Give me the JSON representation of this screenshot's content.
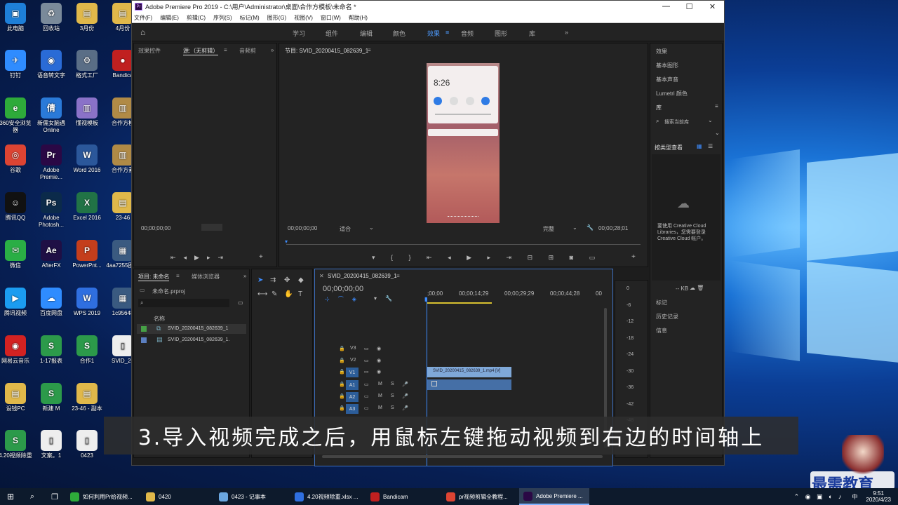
{
  "desktop": {
    "icons": [
      {
        "label": "此电脑",
        "color": "#1e7fd8",
        "glyph": "▣"
      },
      {
        "label": "回收站",
        "color": "#7a8a9a",
        "glyph": "♻"
      },
      {
        "label": "3月份",
        "color": "#e0b84a",
        "glyph": "▤"
      },
      {
        "label": "4月份",
        "color": "#e0b84a",
        "glyph": "▤"
      },
      {
        "label": "钉钉",
        "color": "#2f8cff",
        "glyph": "✈"
      },
      {
        "label": "语音转文字",
        "color": "#2a6bd6",
        "glyph": "◉"
      },
      {
        "label": "格式工厂",
        "color": "#5a6e86",
        "glyph": "⚙"
      },
      {
        "label": "Bandica",
        "color": "#c02020",
        "glyph": "●"
      },
      {
        "label": "360安全浏览器",
        "color": "#2eaa3a",
        "glyph": "e"
      },
      {
        "label": "新儒女脑遇Online",
        "color": "#2a7ad8",
        "glyph": "倩"
      },
      {
        "label": "懂视模板",
        "color": "#8a72c8",
        "glyph": "▥"
      },
      {
        "label": "合作方模",
        "color": "#b08a46",
        "glyph": "▥"
      },
      {
        "label": "谷歌",
        "color": "#dd4433",
        "glyph": "◎"
      },
      {
        "label": "Adobe Premie...",
        "color": "#2a0845",
        "glyph": "Pr"
      },
      {
        "label": "Word 2016",
        "color": "#2b579a",
        "glyph": "W"
      },
      {
        "label": "合作方素",
        "color": "#b08a46",
        "glyph": "▥"
      },
      {
        "label": "腾讯QQ",
        "color": "#111111",
        "glyph": "☺"
      },
      {
        "label": "Adobe Photosh...",
        "color": "#0b2a4a",
        "glyph": "Ps"
      },
      {
        "label": "Excel 2016",
        "color": "#217346",
        "glyph": "X"
      },
      {
        "label": "23-46",
        "color": "#e0b84a",
        "glyph": "▤"
      },
      {
        "label": "微信",
        "color": "#2aae45",
        "glyph": "✉"
      },
      {
        "label": "AfterFX",
        "color": "#1f0f45",
        "glyph": "Ae"
      },
      {
        "label": "PowerPnt...",
        "color": "#c43e1c",
        "glyph": "P"
      },
      {
        "label": "4aa7255图片",
        "color": "#3a5a80",
        "glyph": "▦"
      },
      {
        "label": "腾讯视频",
        "color": "#1b9cf0",
        "glyph": "▶"
      },
      {
        "label": "百度网盘",
        "color": "#2f8cff",
        "glyph": "☁"
      },
      {
        "label": "WPS 2019",
        "color": "#2f6fe0",
        "glyph": "W"
      },
      {
        "label": "1c95648",
        "color": "#3a5a80",
        "glyph": "▦"
      },
      {
        "label": "网易云音乐",
        "color": "#d32222",
        "glyph": "◉"
      },
      {
        "label": "1-17报表",
        "color": "#2c9a4a",
        "glyph": "S"
      },
      {
        "label": "合作1",
        "color": "#2c9a4a",
        "glyph": "S"
      },
      {
        "label": "SVID_20",
        "color": "#eeeeee",
        "glyph": "▯"
      },
      {
        "label": "设钱PC",
        "color": "#e0b84a",
        "glyph": "▤"
      },
      {
        "label": "新建 M",
        "color": "#2c9a4a",
        "glyph": "S"
      },
      {
        "label": "23-46 - 副本",
        "color": "#e0b84a",
        "glyph": "▤"
      },
      {
        "label": "",
        "color": "#00000000",
        "glyph": ""
      },
      {
        "label": "4.20视频除重",
        "color": "#2c9a4a",
        "glyph": "S"
      },
      {
        "label": "文案。1",
        "color": "#eeeeee",
        "glyph": "▯"
      },
      {
        "label": "0423",
        "color": "#eeeeee",
        "glyph": "▯"
      }
    ]
  },
  "premiere": {
    "title": "Adobe Premiere Pro 2019 - C:\\用户\\Administrator\\桌面\\合作方模板\\未命名 *",
    "menu": [
      "文件(F)",
      "编辑(E)",
      "剪辑(C)",
      "序列(S)",
      "标记(M)",
      "图形(G)",
      "视图(V)",
      "窗口(W)",
      "帮助(H)"
    ],
    "workspaces": [
      "学习",
      "组件",
      "编辑",
      "颜色",
      "效果",
      "音频",
      "图形",
      "库"
    ],
    "active_workspace": "效果",
    "source_tabs": [
      "效果控件",
      "源:（无剪辑）",
      "音频剪"
    ],
    "source_tc": "00;00;00;00",
    "program_tab": "节目: SVID_20200415_082639_1",
    "program_tc": "00;00;00;00",
    "program_fit": "适合",
    "program_quality": "完整",
    "program_duration": "00;00;28;01",
    "phone_time": "8:26",
    "right_panel": {
      "items": [
        "效果",
        "基本图形",
        "基本声音",
        "Lumetri 颜色",
        "库"
      ],
      "search_placeholder": "搜索当前库",
      "view_label": "按类型查看",
      "cloud_text": "要使用 Creative Cloud Libraries，您需要登录 Creative Cloud 帐户。",
      "kb": "-- KB",
      "bottom": [
        "标记",
        "历史记录",
        "信息"
      ]
    },
    "project": {
      "tabs": [
        "项目: 未命名",
        "媒体浏览器"
      ],
      "file": "未命名.prproj",
      "col_name": "名称",
      "items": [
        "SVID_20200415_082639_1",
        "SVID_20200415_082639_1."
      ]
    },
    "timeline": {
      "tab": "SVID_20200415_082639_1",
      "tc": "00;00;00;00",
      "ruler": [
        ";00;00",
        "00;00;14;29",
        "00;00;29;29",
        "00;00;44;28",
        "00"
      ],
      "video_tracks": [
        "V3",
        "V2",
        "V1"
      ],
      "audio_tracks": [
        "A1",
        "A2",
        "A3"
      ],
      "clip_label": "SVID_20200415_082639_1.mp4 [V]"
    },
    "meter_labels": [
      "0",
      "-6",
      "-12",
      "-18",
      "-24",
      "-30",
      "-36",
      "-42",
      "-48"
    ]
  },
  "subtitle": "3.导入视频完成之后，用鼠标左键拖动视频到右边的时间轴上",
  "watermark": "最需教育",
  "taskbar": {
    "items": [
      {
        "label": "如何利用Pr给视频...",
        "color": "#2eaa3a"
      },
      {
        "label": "0420",
        "color": "#e0b84a"
      },
      {
        "label": "0423 - 记事本",
        "color": "#6aa6e0"
      },
      {
        "label": "4.20视频除重.xlsx ...",
        "color": "#2f6fe0"
      },
      {
        "label": "Bandicam",
        "color": "#c02020"
      },
      {
        "label": "pr视频剪辑全教程...",
        "color": "#dd4433"
      },
      {
        "label": "Adobe Premiere ...",
        "color": "#2a0845"
      }
    ],
    "ime": "中",
    "time": "9:51",
    "date": "2020/4/23"
  }
}
